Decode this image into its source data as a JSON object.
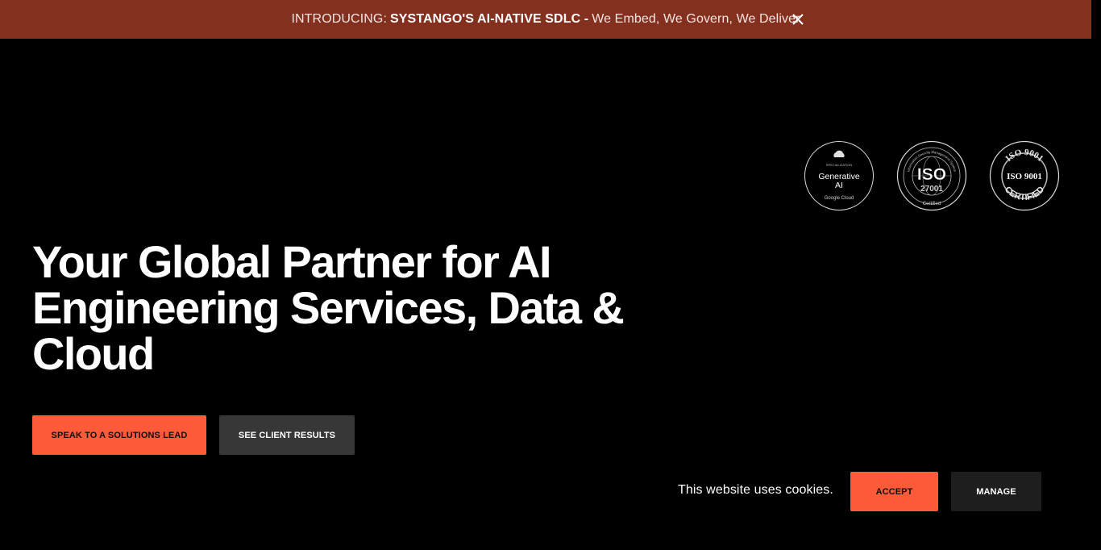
{
  "announcement": {
    "prefix": "INTRODUCING:",
    "highlight": "SYSTANGO'S AI-NATIVE SDLC -",
    "suffix": "We Embed, We Govern, We Deliver",
    "close_icon": "close-icon"
  },
  "badges": [
    {
      "name": "google-cloud-specialization-badge",
      "top": "SPECIALIZATION",
      "line1": "Generative",
      "line2": "AI",
      "bottom": "Google Cloud"
    },
    {
      "name": "iso-27001-badge",
      "ring": "Information Security Management System",
      "main": "ISO",
      "sub": "27001",
      "bottom": "Certified"
    },
    {
      "name": "iso-9001-badge",
      "top": "ISO 9001",
      "main": "ISO 9001",
      "bottom": "CERTIFIED"
    }
  ],
  "hero": {
    "title_line1": "Your Global Partner for AI",
    "title_line2": "Engineering Services, Data &",
    "title_line3": "Cloud",
    "primary_cta": "SPEAK TO A SOLUTIONS LEAD",
    "secondary_cta": "SEE CLIENT RESULTS"
  },
  "cookie": {
    "message": "This website uses cookies.",
    "accept": "ACCEPT",
    "manage": "MANAGE"
  },
  "colors": {
    "banner": "#83301f",
    "accent": "#fd5a3a",
    "background": "#000000",
    "secondary_button": "#373737"
  }
}
